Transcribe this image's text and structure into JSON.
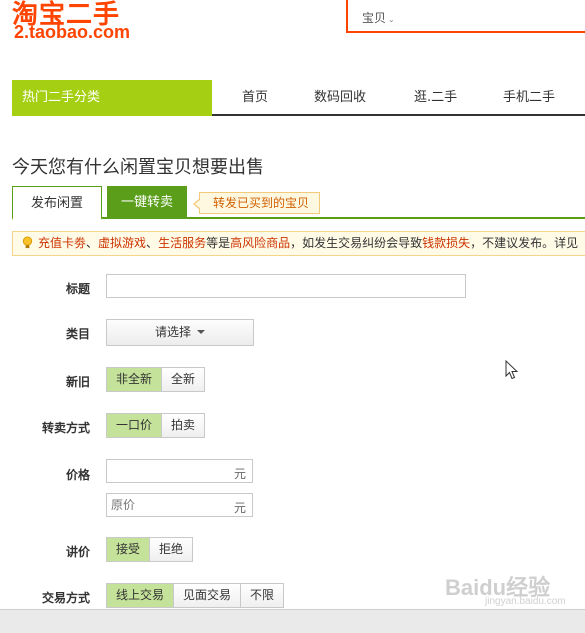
{
  "logo": {
    "main": "淘宝二手",
    "sub": "2.taobao.com"
  },
  "search": {
    "scope": "宝贝",
    "placeholder": ""
  },
  "nav": {
    "category": "热门二手分类",
    "items": [
      "首页",
      "数码回收",
      "逛.二手",
      "手机二手"
    ]
  },
  "page_title": "今天您有什么闲置宝贝想要出售",
  "tabs": {
    "publish": "发布闲置",
    "resell": "一键转卖",
    "hint": "转发已买到的宝贝"
  },
  "warning": {
    "t1": "充值卡劵",
    "s1": "、",
    "t2": "虚拟游戏",
    "s2": "、",
    "t3": "生活服务",
    "s3": "等是",
    "t4": "高风险商品",
    "s4": "，如发生交易纠纷会导致",
    "t5": "钱款损失",
    "s5": "，不建议发布。详见"
  },
  "form": {
    "title_label": "标题",
    "title_value": "",
    "category_label": "类目",
    "category_select": "请选择",
    "condition_label": "新旧",
    "condition_options": [
      "非全新",
      "全新"
    ],
    "sale_label": "转卖方式",
    "sale_options": [
      "一口价",
      "拍卖"
    ],
    "price_label": "价格",
    "price_placeholder": "",
    "price_unit": "元",
    "orig_placeholder": "原价",
    "orig_unit": "元",
    "bargain_label": "讲价",
    "bargain_options": [
      "接受",
      "拒绝"
    ],
    "trade_label": "交易方式",
    "trade_options": [
      "线上交易",
      "见面交易",
      "不限"
    ]
  },
  "watermark": {
    "text": "Baidu经验",
    "sub": "jingyan.baidu.com"
  },
  "colors": {
    "brand": "#ff4400",
    "nav_green": "#a5cf12",
    "tab_green": "#5a9e1a",
    "active_option": "#c5e29a"
  }
}
